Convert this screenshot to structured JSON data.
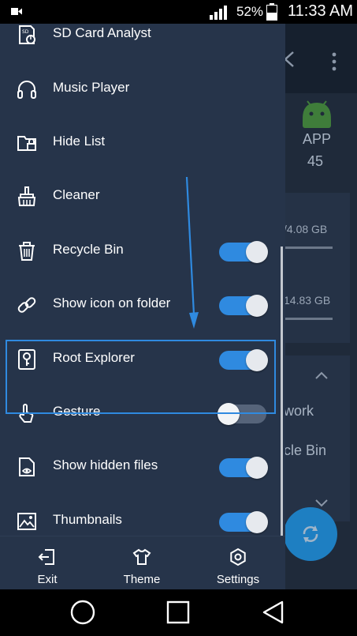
{
  "status_bar": {
    "battery_percent": "52%",
    "time": "11:33 AM",
    "icons": [
      "video-camera-icon",
      "signal-icon",
      "battery-icon"
    ]
  },
  "background_app": {
    "app_category_label": "APP",
    "app_count": "45",
    "storage_1": "/4.08 GB",
    "storage_2": "14.83 GB",
    "list_item_1": "work",
    "list_item_2": "cle Bin"
  },
  "drawer": {
    "items": [
      {
        "label": "SD Card Analyst",
        "icon": "sd-card-analyst-icon"
      },
      {
        "label": "Music Player",
        "icon": "headphones-icon"
      },
      {
        "label": "Hide List",
        "icon": "hidden-folder-icon"
      },
      {
        "label": "Cleaner",
        "icon": "broom-icon"
      },
      {
        "label": "Recycle Bin",
        "icon": "trash-icon",
        "toggle": true
      },
      {
        "label": "Show icon on folder",
        "icon": "link-icon",
        "toggle": true
      },
      {
        "label": "Root Explorer",
        "icon": "key-icon",
        "toggle": true
      },
      {
        "label": "Gesture",
        "icon": "gesture-hand-icon",
        "toggle": false
      },
      {
        "label": "Show hidden files",
        "icon": "hidden-file-icon",
        "toggle": true
      },
      {
        "label": "Thumbnails",
        "icon": "image-icon",
        "toggle": true
      }
    ],
    "highlighted_item": "Root Explorer",
    "footer": {
      "exit_label": "Exit",
      "theme_label": "Theme",
      "settings_label": "Settings"
    }
  },
  "colors": {
    "drawer_bg": "#26344a",
    "accent": "#2f8ae0",
    "toggle_off_track": "#56647a"
  }
}
